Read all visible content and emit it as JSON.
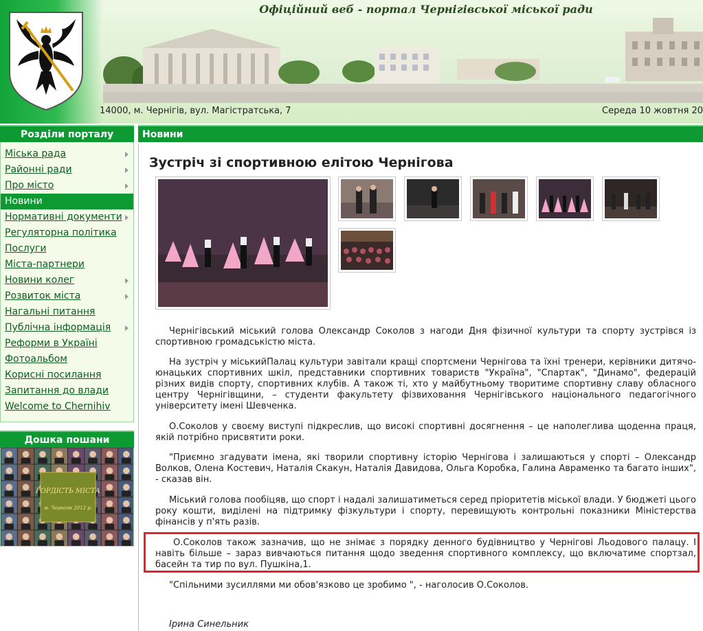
{
  "header": {
    "site_title": "Офіційний веб - портал Чернігівської міської ради",
    "address": "14000, м. Чернігів, вул. Магістратська, 7",
    "date": "Середа 10 жовтня 20"
  },
  "sidebar": {
    "portal_sections_title": "Розділи порталу",
    "items": [
      {
        "label": "Міська рада",
        "has_submenu": true,
        "active": false
      },
      {
        "label": "Районні ради",
        "has_submenu": true,
        "active": false
      },
      {
        "label": "Про місто",
        "has_submenu": true,
        "active": false
      },
      {
        "label": "Новини",
        "has_submenu": false,
        "active": true
      },
      {
        "label": "Нормативні документи",
        "has_submenu": true,
        "active": false
      },
      {
        "label": "Регуляторна політика",
        "has_submenu": false,
        "active": false
      },
      {
        "label": "Послуги",
        "has_submenu": false,
        "active": false
      },
      {
        "label": "Міста-партнери",
        "has_submenu": false,
        "active": false
      },
      {
        "label": "Новини колег",
        "has_submenu": true,
        "active": false
      },
      {
        "label": "Розвиток міста",
        "has_submenu": true,
        "active": false
      },
      {
        "label": "Нагальні питання",
        "has_submenu": false,
        "active": false
      },
      {
        "label": "Публічна інформація",
        "has_submenu": true,
        "active": false
      },
      {
        "label": "Реформи в Україні",
        "has_submenu": false,
        "active": false
      },
      {
        "label": "Фотоальбом",
        "has_submenu": false,
        "active": false
      },
      {
        "label": "Корисні посилання",
        "has_submenu": false,
        "active": false
      },
      {
        "label": "Запитання до влади",
        "has_submenu": false,
        "active": false
      },
      {
        "label": "Welcome to Chernihiv",
        "has_submenu": false,
        "active": false
      }
    ],
    "honor_board_title": "Дошка пошани",
    "honor_board_banner": "ГОРДІСТЬ МІСТА",
    "honor_board_subtitle": "м. Чернігів 2012 р."
  },
  "main": {
    "section_title": "Новини",
    "article_title": "Зустріч зі спортивною елітою Чернігова",
    "paragraphs": [
      "Чернігівський міський голова Олександр Соколов з нагоди Дня фізичної культури та спорту зустрівся із спортивною громадськістю міста.",
      "На зустріч у міськийПалац культури завітали кращі спортсмени Чернігова та їхні тренери, керівники дитячо-юнацьких спортивних шкіл, представники спортивних товариств \"Україна\", \"Спартак\", \"Динамо\", федерацій різних видів спорту, спортивних клубів. А також ті, хто у майбутньому творитиме спортивну славу обласного центру Чернігівщини, – студенти факультету фізвиховання Чернігівського національного педагогічного університету імені Шевченка.",
      "О.Соколов у своєму виступі підкреслив, що високі спортивні досягнення – це наполеглива щоденна праця, якій потрібно присвятити роки.",
      "\"Приємно згадувати імена, які творили спортивну історію Чернігова і залишаються у спорті – Олександр Волков, Олена Костевич, Наталія Скакун, Наталія Давидова, Ольга Коробка, Галина Авраменко та багато інших\", - сказав він.",
      "Міський голова пообіцяв, що спорт і надалі залишатиметься серед пріоритетів міської влади. У бюджеті цього року кошти, виділені на підтримку фізкультури і спорту, перевищують контрольні показники Міністерства фінансів у п'ять разів.",
      "О.Соколов також зазначив, що не знімає з порядку денного будівництво у Чернігові Льодового палацу. І навіть більше – зараз вивчаються питання щодо зведення спортивного комплексу, що включатиме спортзал, басейн та тир по вул. Пушкіна,1.",
      "\"Спільними зусиллями ми обов'язково це зробимо \", - наголосив О.Соколов."
    ],
    "author": "Ірина Синельник"
  },
  "colors": {
    "accent_green": "#0d9a33",
    "link_green": "#0b5f20",
    "highlight_red": "#e0242b"
  }
}
